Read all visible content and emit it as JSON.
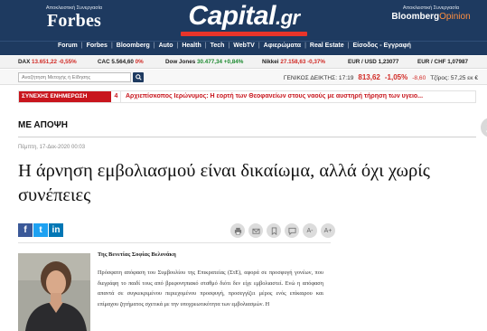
{
  "header": {
    "forbes_kicker": "Αποκλειστική Συνεργασία",
    "forbes_logo": "Forbes",
    "capital_logo_main": "Capital",
    "capital_logo_suffix": ".gr",
    "bloomberg_kicker": "Αποκλειστική Συνεργασία",
    "bloomberg_logo_main": "Bloomberg",
    "bloomberg_logo_suffix": "Opinion"
  },
  "nav": {
    "items": [
      "Forum",
      "Forbes",
      "Bloomberg",
      "Auto",
      "Health",
      "Tech",
      "WebTV",
      "Αφιερώματα",
      "Real Estate",
      "Είσοδος - Εγγραφή"
    ]
  },
  "market": [
    {
      "name": "DAX",
      "value": "13.651,22",
      "change": "-0,55%",
      "dir": "neg"
    },
    {
      "name": "CAC",
      "value": "5.564,60",
      "change": "0%",
      "dir": "neg"
    },
    {
      "name": "Dow Jones",
      "value": "30.477,34",
      "change": "+0,84%",
      "dir": "pos"
    },
    {
      "name": "Nikkei",
      "value": "27.158,63",
      "change": "-0,37%",
      "dir": "neg"
    },
    {
      "name": "EUR / USD",
      "value": "1,23077",
      "change": "",
      "dir": "none"
    },
    {
      "name": "EUR / CHF",
      "value": "1,07987",
      "change": "",
      "dir": "none"
    }
  ],
  "search": {
    "placeholder": "Αναζήτηση Μετοχής ή Είδησης"
  },
  "index": {
    "label": "ΓΕΝΙΚΟΣ ΔΕΙΚΤΗΣ: 17:19",
    "value": "813,62",
    "pct": "-1,05%",
    "change": "-8,60",
    "turnover": "Τζίρος: 57,25 εκ €"
  },
  "breaking": {
    "label": "ΣΥΝΕΧΗΣ ΕΝΗΜΕΡΩΣΗ",
    "number": "4",
    "text": "Αρχιεπίσκοπος Ιερώνυμος: Η εορτή των Θεοφανείων στους ναούς με αυστηρή τήρηση των υγειο..."
  },
  "article": {
    "section": "ΜΕ ΑΠΟΨΗ",
    "date": "Πέμπτη, 17-Δεκ-2020 00:03",
    "headline": "Η άρνηση εμβολιασμού είναι δικαίωμα, αλλά όχι χωρίς συνέπειες",
    "byline": "Της Βενετίας Σοφίας Βελονάκη",
    "body": "Πρόσφατη απόφαση του Συμβουλίου της Επικρατείας (ΣτΕ), αφορά σε προσφυγή γονέων, που διεγράφη το παιδί τους από βρεφονηπιακό σταθμό διότι δεν είχε εμβολιαστεί. Ενώ η απόφαση απαντά σε συγκεκριμένου περιεχομένου προσφυγή, προσεγγίζει μέρος ενός επίκαιρου και επίμαχου ζητήματος σχετικά με την υποχρεωτικότητα των εμβολιασμών. Η"
  },
  "share": {
    "facebook": "f",
    "twitter": "t",
    "linkedin": "in"
  },
  "tools": [
    "print",
    "email",
    "bookmark",
    "comment",
    "font-decrease",
    "font-increase"
  ],
  "tool_labels": {
    "font_decrease": "A-",
    "font_increase": "A+"
  },
  "colors": {
    "header_bg": "#1e3a60",
    "brand_red": "#e8342a",
    "breaking_red": "#c8161d",
    "negative": "#d12a25",
    "positive": "#1c8a2f"
  }
}
